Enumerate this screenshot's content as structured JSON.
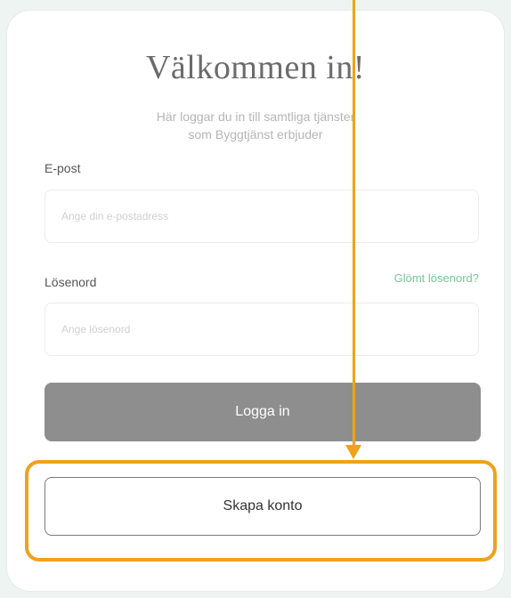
{
  "login_form": {
    "title": "Välkommen in!",
    "subtitle_line1": "Här loggar du in till samtliga tjänster",
    "subtitle_line2": "som Byggtjänst erbjuder",
    "email_label": "E-post",
    "email_placeholder": "Ange din e-postadress",
    "email_value": "",
    "password_label": "Lösenord",
    "password_placeholder": "Ange lösenord",
    "password_value": "",
    "forgot_password": "Glömt lösenord?",
    "login_button": "Logga in",
    "create_account_button": "Skapa konto"
  },
  "annotation": {
    "color": "#f0a21c"
  },
  "colors": {
    "accent_link": "#78c49a",
    "login_button_bg": "#8e8e8e",
    "page_bg": "#eef4f1"
  }
}
